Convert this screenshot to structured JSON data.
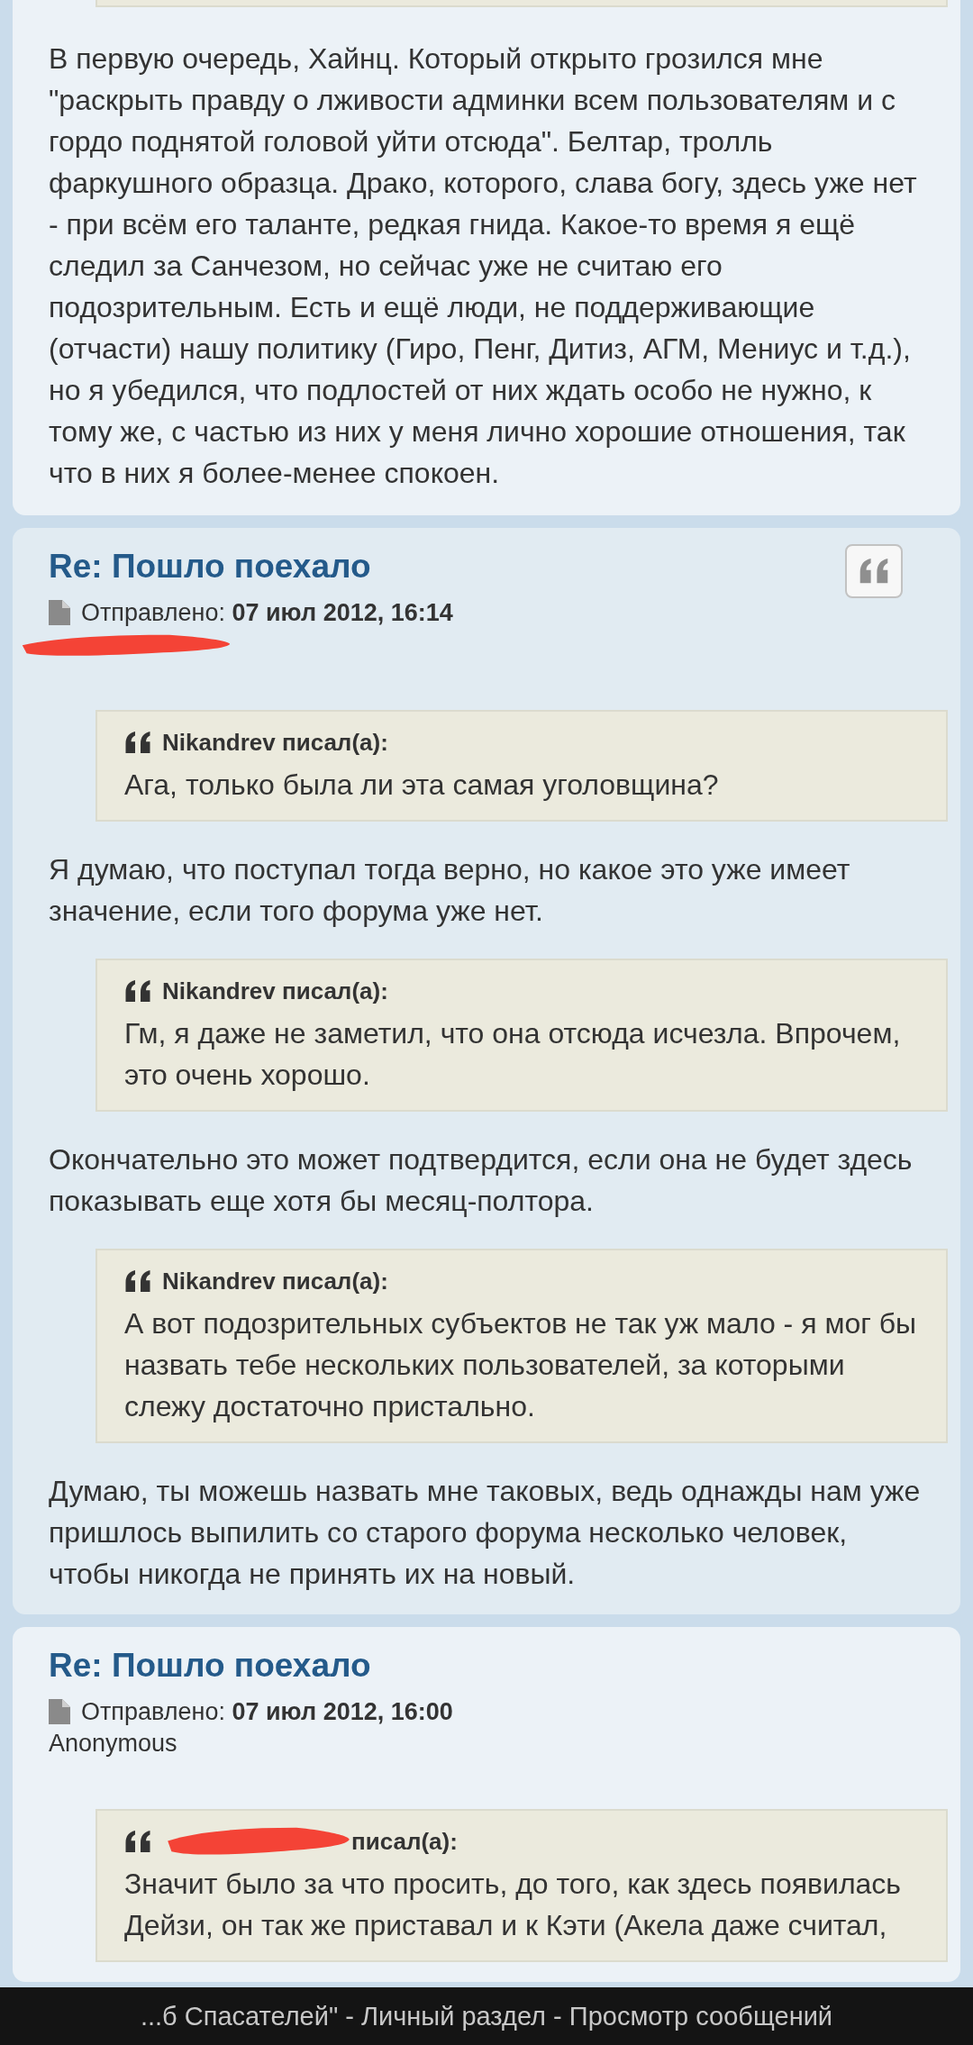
{
  "posts": [
    {
      "quote_button": false,
      "blocks": [
        {
          "kind": "quote_end"
        },
        {
          "kind": "text",
          "text": "В первую очередь, Хайнц. Который открыто грозился мне \"раскрыть правду о лживости админки всем пользователям и с гордо поднятой головой уйти отсюда\". Белтар, тролль фаркушного образца. Драко, которого, слава богу, здесь уже нет - при всём его таланте, редкая гнида. Какое-то время я ещё следил за Санчезом, но сейчас уже не считаю его подозрительным. Есть и ещё люди, не поддерживающие (отчасти) нашу политику (Гиро, Пенг, Дитиз, АГМ, Мениус и т.д.), но я убедился, что подлостей от них ждать особо не нужно, к тому же, с частью из них у меня лично хорошие отношения, так что в них я более-менее спокоен."
        }
      ]
    },
    {
      "title": "Re: Пошло поехало",
      "quote_button": true,
      "posted_label": "Отправлено:",
      "date": "07 июл 2012, 16:14",
      "author_redacted": true,
      "blocks": [
        {
          "kind": "quote",
          "author": "Nikandrev писал(а):",
          "author_redacted": false,
          "text": "Ага, только была ли эта самая уголовщина?"
        },
        {
          "kind": "text",
          "text": "Я думаю, что поступал тогда верно, но какое это уже имеет значение, если того форума уже нет."
        },
        {
          "kind": "quote",
          "author": "Nikandrev писал(а):",
          "author_redacted": false,
          "text": "Гм, я даже не заметил, что она отсюда исчезла. Впрочем, это очень хорошо."
        },
        {
          "kind": "text",
          "text": "Окончательно это может подтвердится, если она не будет здесь показывать еще хотя бы месяц-полтора."
        },
        {
          "kind": "quote",
          "author": "Nikandrev писал(а):",
          "author_redacted": false,
          "text": "А вот подозрительных субъектов не так уж мало - я мог бы назвать тебе нескольких пользователей, за которыми слежу достаточно пристально."
        },
        {
          "kind": "text",
          "text": "Думаю, ты можешь назвать мне таковых, ведь однажды нам уже пришлось выпилить со старого форума несколько человек, чтобы никогда не принять их на новый."
        }
      ]
    },
    {
      "title": "Re: Пошло поехало",
      "quote_button": false,
      "posted_label": "Отправлено:",
      "date": "07 июл 2012, 16:00",
      "author": "Anonymous",
      "author_redacted": false,
      "blocks": [
        {
          "kind": "quote",
          "author": "писал(а):",
          "author_redacted": true,
          "text": "Значит было за что просить, до того, как здесь появилась Дейзи, он так же приставал и к Кэти (Акела даже считал,"
        }
      ]
    }
  ],
  "bottom_bar": {
    "title": "...б Спасателей\" - Личный раздел - Просмотр сообщений"
  }
}
